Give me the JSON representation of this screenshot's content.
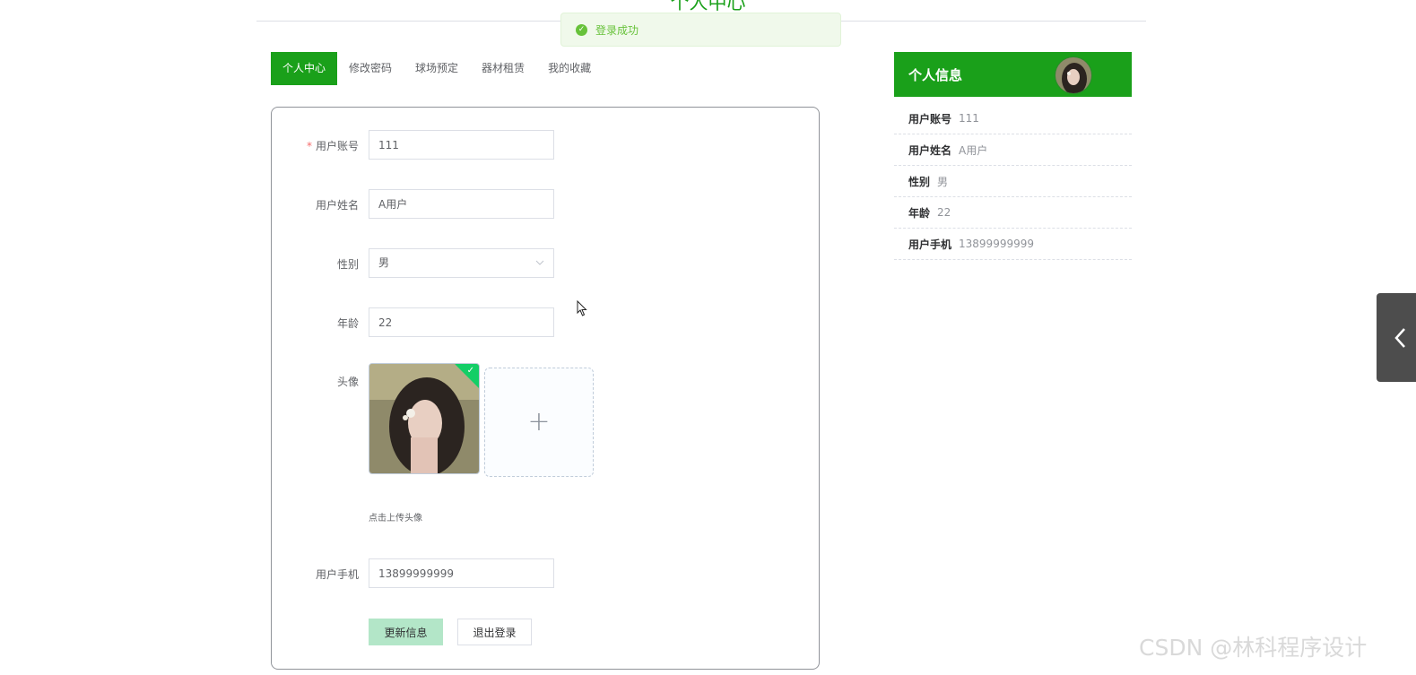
{
  "page": {
    "title": "个人中心"
  },
  "toast": {
    "message": "登录成功",
    "icon": "check-circle-icon",
    "color": "#67c23a"
  },
  "tabs": [
    {
      "label": "个人中心",
      "active": true
    },
    {
      "label": "修改密码",
      "active": false
    },
    {
      "label": "球场预定",
      "active": false
    },
    {
      "label": "器材租赁",
      "active": false
    },
    {
      "label": "我的收藏",
      "active": false
    }
  ],
  "form": {
    "account": {
      "label": "用户账号",
      "value": "111",
      "required": true
    },
    "name": {
      "label": "用户姓名",
      "value": "A用户"
    },
    "gender": {
      "label": "性别",
      "value": "男"
    },
    "age": {
      "label": "年龄",
      "value": "22"
    },
    "avatar": {
      "label": "头像",
      "tip": "点击上传头像",
      "upload_icon": "plus-icon"
    },
    "phone": {
      "label": "用户手机",
      "value": "13899999999"
    },
    "buttons": {
      "update": "更新信息",
      "logout": "退出登录"
    }
  },
  "info_panel": {
    "title": "个人信息",
    "rows": [
      {
        "key": "用户账号",
        "value": "111"
      },
      {
        "key": "用户姓名",
        "value": "A用户"
      },
      {
        "key": "性别",
        "value": "男"
      },
      {
        "key": "年龄",
        "value": "22"
      },
      {
        "key": "用户手机",
        "value": "13899999999"
      }
    ]
  },
  "side_toggle": {
    "icon": "chevron-left-icon"
  },
  "watermark": "CSDN @林科程序设计",
  "colors": {
    "brand": "#1aa01a",
    "success": "#13ce66",
    "primary_button": "#b3e6c8"
  }
}
